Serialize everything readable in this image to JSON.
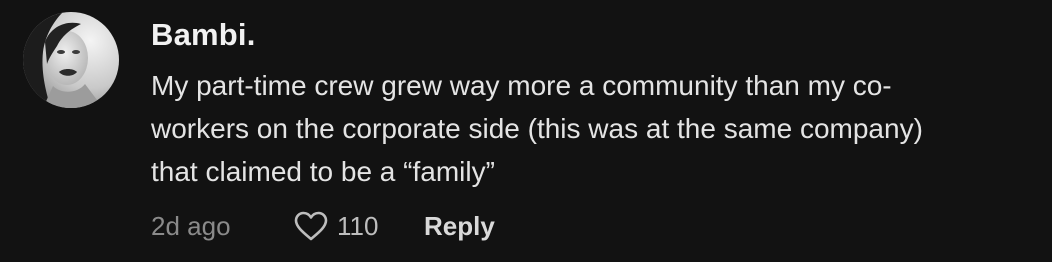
{
  "comment": {
    "username": "Bambi.",
    "text_lines": [
      "My part-time crew grew way more a community than my co-",
      "workers on the corporate side (this was at the same company)",
      "that claimed to be a “family”"
    ],
    "timestamp": "2d ago",
    "like_count": "110",
    "reply_label": "Reply",
    "avatar_icon": "profile-photo",
    "like_icon": "heart-outline-icon"
  },
  "colors": {
    "background": "#121212",
    "username": "#f1f1f1",
    "body_text": "#e4e4e4",
    "timestamp": "#8a8a8a"
  }
}
